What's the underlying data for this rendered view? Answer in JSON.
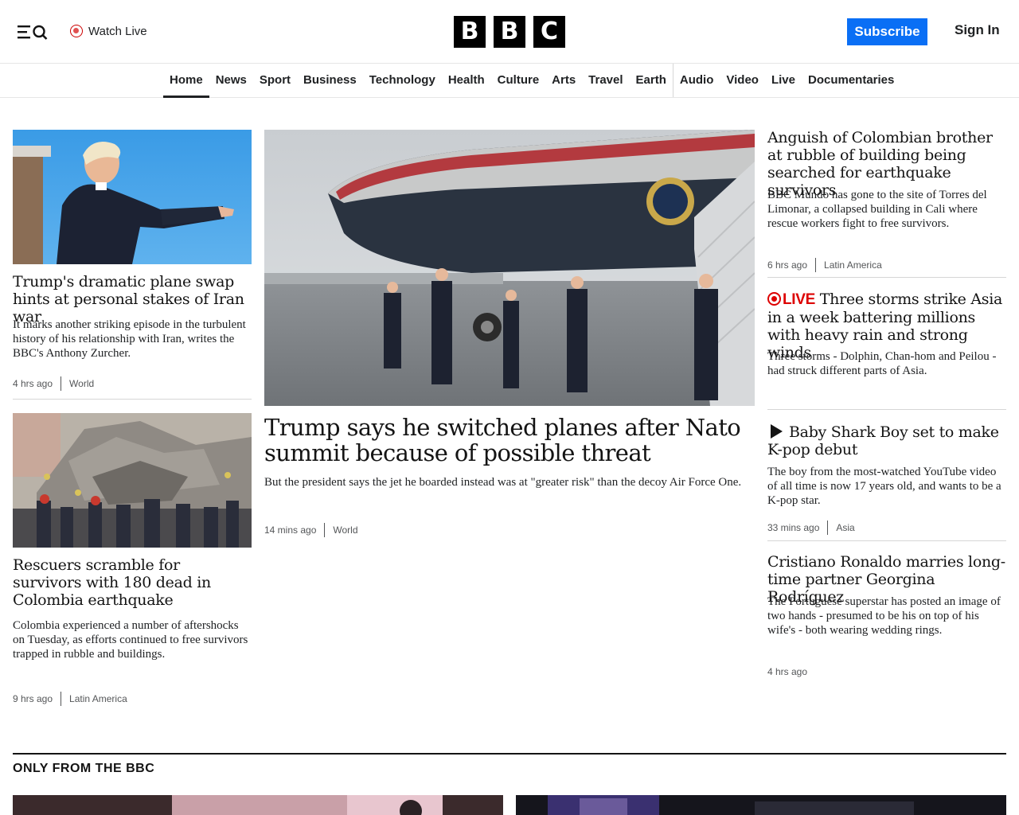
{
  "header": {
    "watch_live": "Watch Live",
    "logo_letters": [
      "B",
      "B",
      "C"
    ],
    "subscribe": "Subscribe",
    "sign_in": "Sign In",
    "icons": [
      "menu-icon",
      "search-icon",
      "live-dot-icon"
    ],
    "accent_color": "#0a6ff5"
  },
  "nav": {
    "items": [
      "Home",
      "News",
      "Sport",
      "Business",
      "Technology",
      "Health",
      "Culture",
      "Arts",
      "Travel",
      "Earth",
      "Audio",
      "Video",
      "Live",
      "Documentaries"
    ],
    "active": "Home"
  },
  "stories": {
    "left1": {
      "headline": "Trump's dramatic plane swap hints at personal stakes of Iran war",
      "summary": "It marks another striking episode in the turbulent history of his relationship with Iran, writes the BBC's Anthony Zurcher.",
      "time": "4 hrs ago",
      "section": "World"
    },
    "left2": {
      "headline": "Rescuers scramble for survivors with 180 dead in Colombia earthquake",
      "summary": "Colombia experienced a number of aftershocks on Tuesday, as efforts continued to free survivors trapped in rubble and buildings.",
      "time": "9 hrs ago",
      "section": "Latin America"
    },
    "main": {
      "headline": "Trump says he switched planes after Nato summit because of possible threat",
      "summary": "But the president says the jet he boarded instead was at \"greater risk\" than the decoy Air Force One.",
      "time": "14 mins ago",
      "section": "World"
    },
    "right1": {
      "headline": "Anguish of Colombian brother at rubble of building being searched for earthquake survivors",
      "summary": "BBC Mundo has gone to the site of Torres del Limonar, a collapsed building in Cali where rescue workers fight to free survivors.",
      "time": "6 hrs ago",
      "section": "Latin America"
    },
    "right2": {
      "live_label": "LIVE",
      "headline": "Three storms strike Asia in a week battering millions with heavy rain and strong winds",
      "summary": "Three storms - Dolphin, Chan-hom and Peilou - had struck different parts of Asia.",
      "live_color": "#dd0000"
    },
    "right3": {
      "headline": "Baby Shark Boy set to make K-pop debut",
      "summary": "The boy from the most-watched YouTube video of all time is now 17 years old, and wants to be a K-pop star.",
      "time": "33 mins ago",
      "section": "Asia"
    },
    "right4": {
      "headline": "Cristiano Ronaldo marries long-time partner Georgina Rodríguez",
      "summary": "The Portuguese superstar has posted an image of two hands - presumed to be his on top of his wife's - both wearing wedding rings.",
      "time": "4 hrs ago"
    }
  },
  "only_from_bbc": {
    "title": "ONLY FROM THE BBC"
  }
}
